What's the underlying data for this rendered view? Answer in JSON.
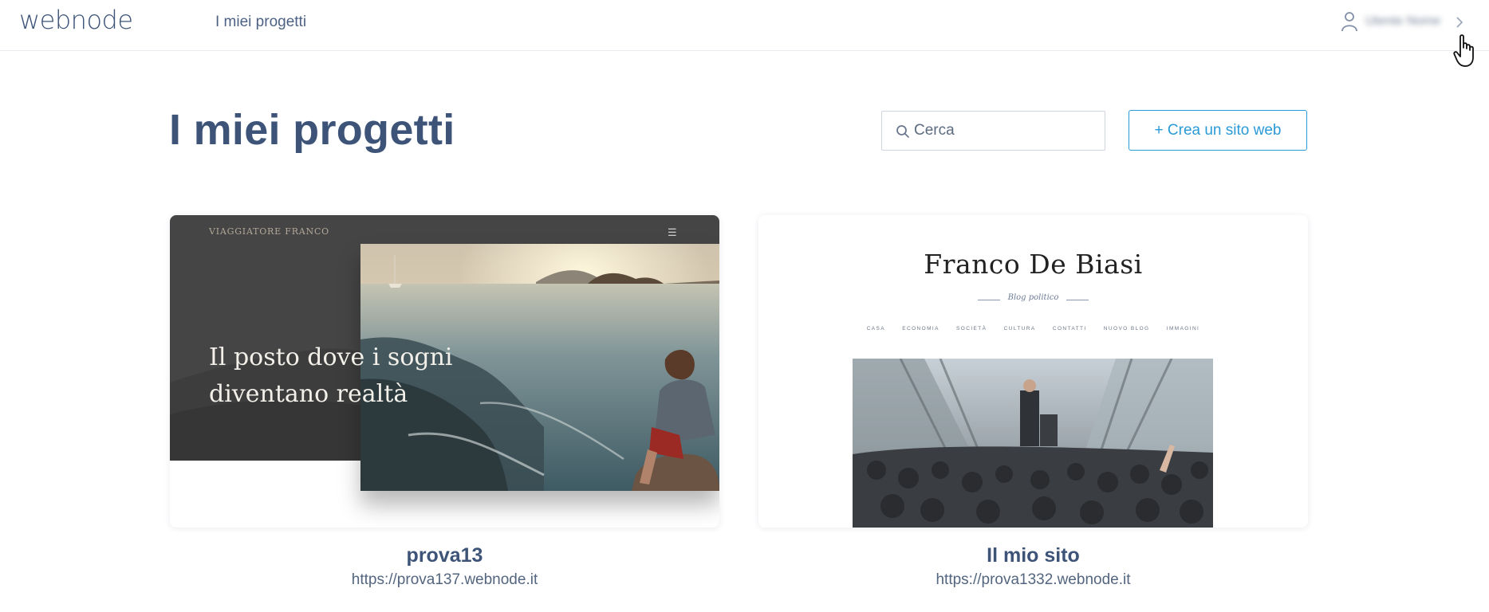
{
  "header": {
    "logo": "webnode",
    "nav_label": "I miei progetti",
    "user_name": "Utente Nome"
  },
  "page": {
    "title": "I miei progetti"
  },
  "search": {
    "placeholder": "Cerca",
    "value": ""
  },
  "actions": {
    "create_label": "+ Crea un sito web"
  },
  "projects": [
    {
      "name": "prova13",
      "url": "https://prova137.webnode.it",
      "preview": {
        "brand": "VIAGGIATORE FRANCO",
        "headline_line1": "Il posto dove i sogni",
        "headline_line2": "diventano realtà"
      }
    },
    {
      "name": "Il mio sito",
      "url": "https://prova1332.webnode.it",
      "preview": {
        "title": "Franco De Biasi",
        "subtitle": "Blog politico",
        "nav": [
          "CASA",
          "ECONOMIA",
          "SOCIETÀ",
          "CULTURA",
          "CONTATTI",
          "NUOVO BLOG",
          "IMMAGINI"
        ]
      }
    }
  ],
  "colors": {
    "brand_text": "#3d5478",
    "accent_blue": "#2a9ad6",
    "border": "#cfd5de"
  },
  "icons": {
    "user": "user-icon",
    "chevron": "chevron-right-icon",
    "search": "search-icon",
    "menu": "hamburger-menu-icon",
    "cursor": "hand-pointer-cursor-icon"
  }
}
